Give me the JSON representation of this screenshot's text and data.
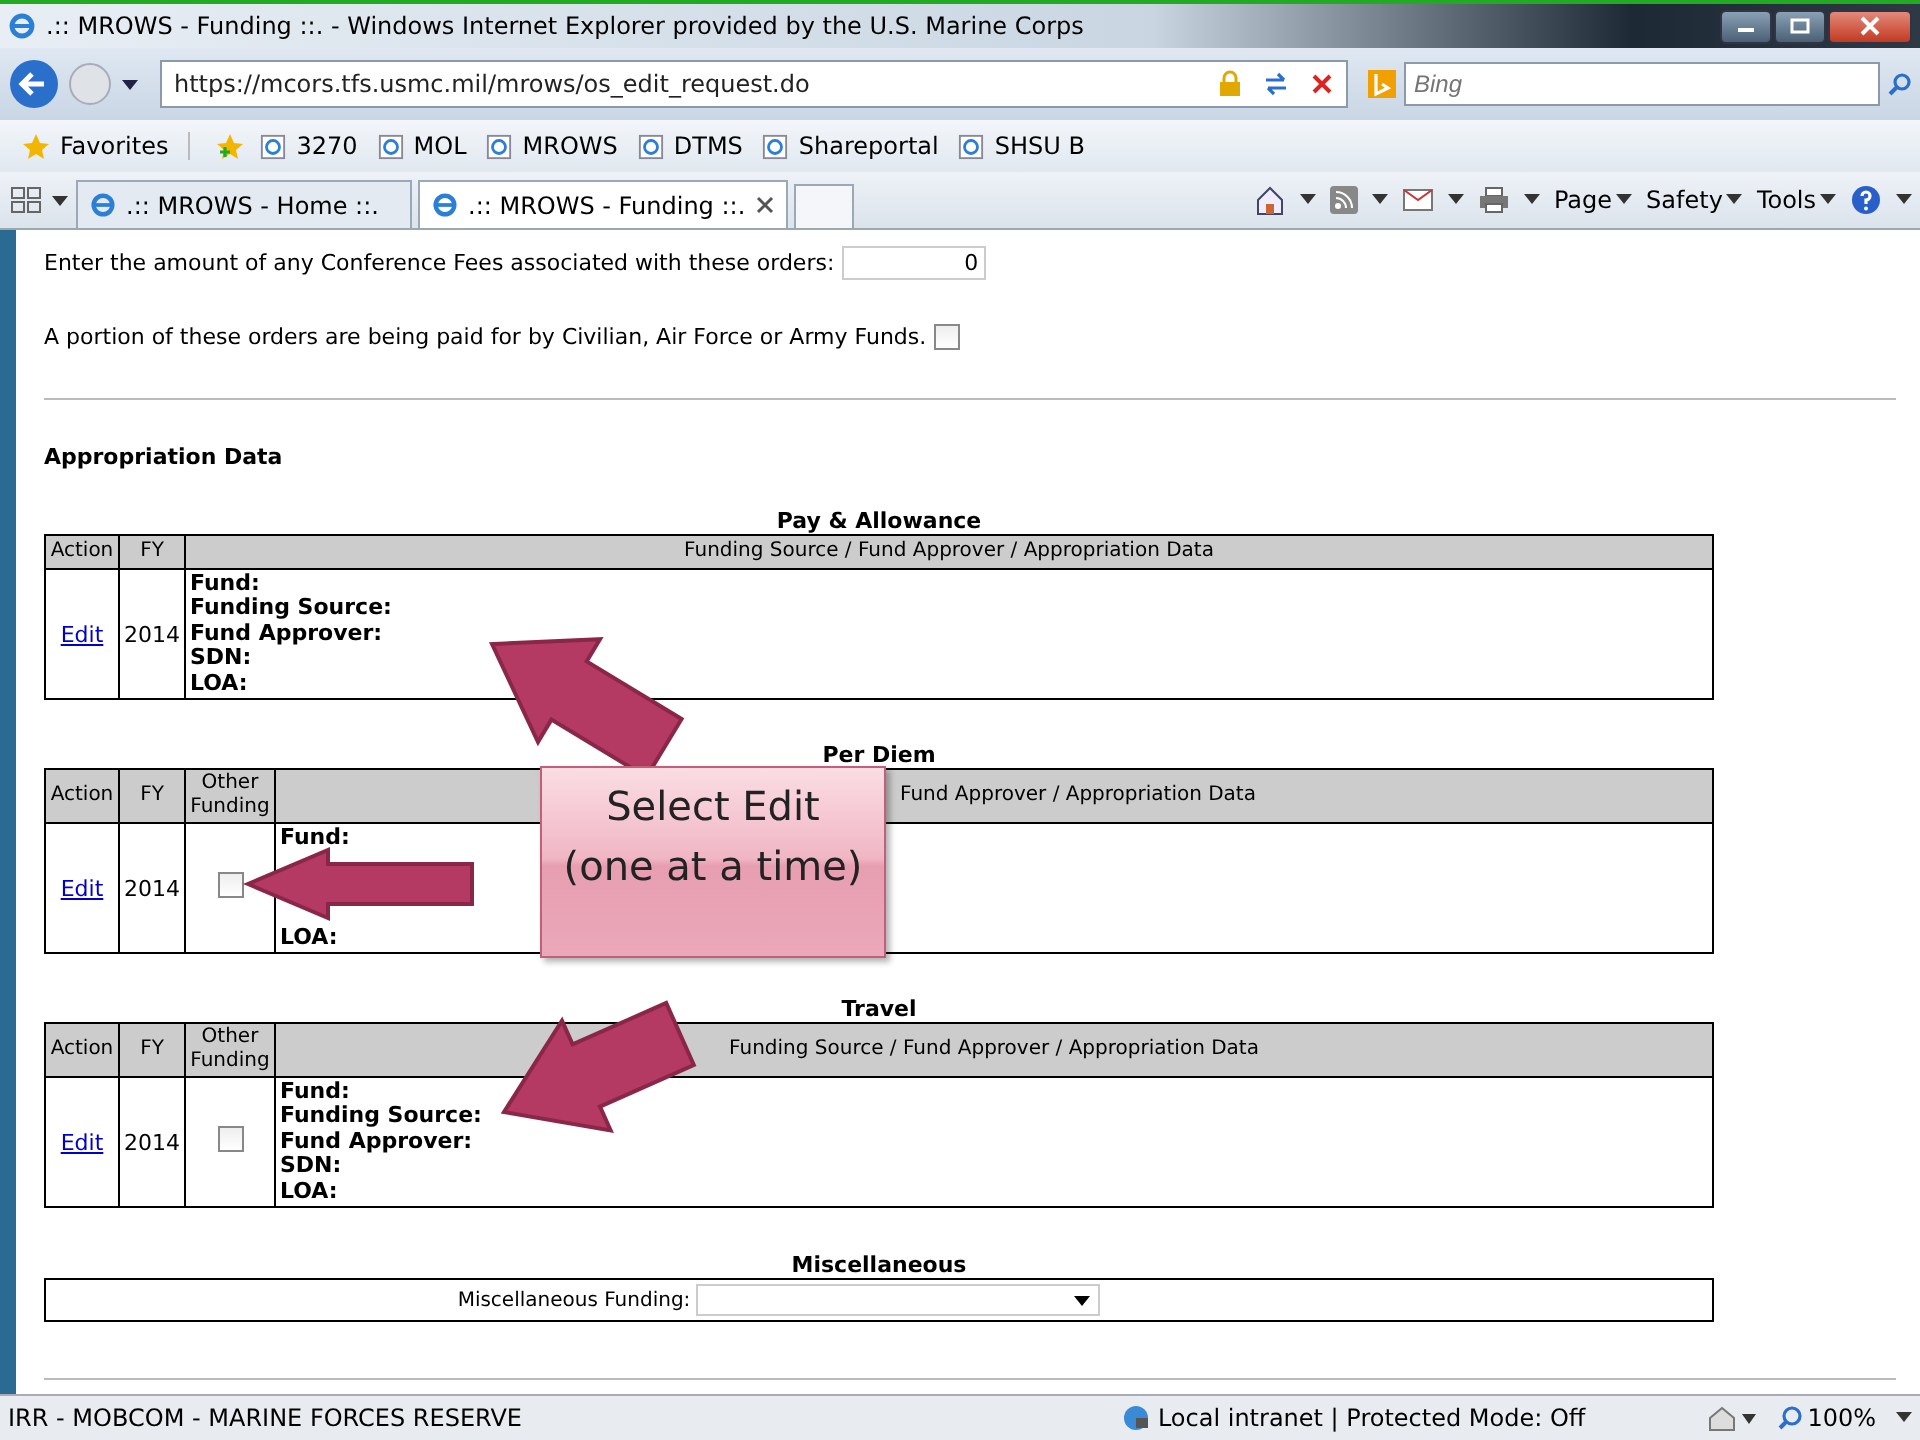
{
  "window": {
    "title": ".:: MROWS - Funding ::. - Windows Internet Explorer provided by the U.S. Marine Corps"
  },
  "address_bar": {
    "url": "https://mcors.tfs.usmc.mil/mrows/os_edit_request.do",
    "search_placeholder": "Bing"
  },
  "favorites_bar": {
    "label": "Favorites",
    "items": [
      "3270",
      "MOL",
      "MROWS",
      "DTMS",
      "Shareportal",
      "SHSU B"
    ]
  },
  "tabs": [
    {
      "label": ".:: MROWS - Home ::.",
      "selected": false
    },
    {
      "label": ".:: MROWS - Funding ::.",
      "selected": true
    }
  ],
  "command_bar": [
    "Page",
    "Safety",
    "Tools"
  ],
  "form": {
    "conference_fees": {
      "label": "Enter the amount of any Conference Fees associated with these orders:",
      "value": "0"
    },
    "other_funds": {
      "label": "A portion of these orders are being paid for by Civilian, Air Force or Army Funds.",
      "checked": false
    }
  },
  "section_title": "Appropriation Data",
  "tables": [
    {
      "title": "Pay & Allowance",
      "columns": [
        "Action",
        "FY",
        "Funding Source / Fund Approver / Appropriation Data"
      ],
      "rows": [
        {
          "action": "Edit",
          "fy": "2014",
          "fields": [
            "Fund:",
            "Funding Source:",
            "Fund Approver:",
            "SDN:",
            "LOA:"
          ]
        }
      ]
    },
    {
      "title": "Per Diem",
      "columns": [
        "Action",
        "FY",
        "Other Funding",
        "Fund Approver / Appropriation Data"
      ],
      "rows": [
        {
          "action": "Edit",
          "fy": "2014",
          "checked": false,
          "fields": [
            "Fund:",
            "LOA:"
          ]
        }
      ]
    },
    {
      "title": "Travel",
      "columns": [
        "Action",
        "FY",
        "Other Funding",
        "Funding Source / Fund Approver / Appropriation Data"
      ],
      "rows": [
        {
          "action": "Edit",
          "fy": "2014",
          "checked": false,
          "fields": [
            "Fund:",
            "Funding Source:",
            "Fund Approver:",
            "SDN:",
            "LOA:"
          ]
        }
      ]
    }
  ],
  "miscellaneous": {
    "title": "Miscellaneous",
    "label": "Miscellaneous Funding:"
  },
  "callout": {
    "text": "Select Edit (one at a time)"
  },
  "status_bar": {
    "text": "IRR - MOBCOM - MARINE FORCES RESERVE",
    "zone": "Local intranet | Protected Mode: Off",
    "zoom": "100%"
  }
}
